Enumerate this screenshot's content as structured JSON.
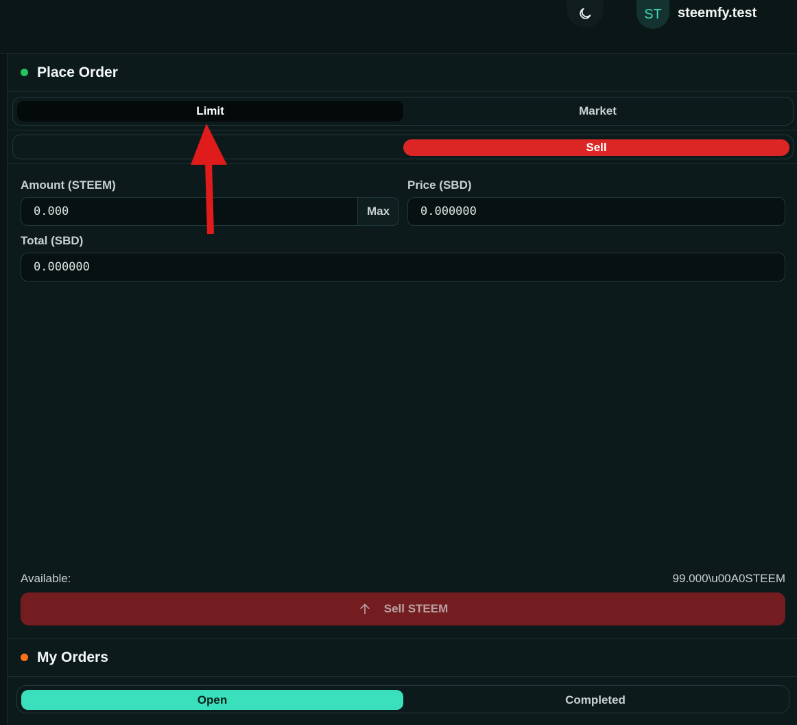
{
  "header": {
    "theme_icon": "moon-icon",
    "avatar_initials": "ST",
    "username": "steemfy.test"
  },
  "place_order": {
    "title": "Place Order",
    "dot_color": "#22c55e",
    "order_types": [
      "Limit",
      "Market"
    ],
    "selected_order_type": "Limit",
    "sides": [
      "Buy",
      "Sell"
    ],
    "selected_side": "Sell",
    "visible_buy_fragment": "y",
    "amount_label": "Amount (STEEM)",
    "amount_value": "0.000",
    "max_label": "Max",
    "price_label": "Price (SBD)",
    "price_value": "0.000000",
    "total_label": "Total (SBD)",
    "total_value": "0.000000",
    "available_label": "Available:",
    "available_value": "99.000\\u00A0STEEM",
    "submit_label": "Sell STEEM",
    "submit_icon": "arrow-up-icon"
  },
  "my_orders": {
    "title": "My Orders",
    "dot_color": "#f97316",
    "tabs": [
      "Open",
      "Completed"
    ],
    "selected_tab": "Open"
  },
  "colors": {
    "accent_teal": "#3ae0bc",
    "sell_red": "#dc2626",
    "sell_button_disabled": "#741d21",
    "annotation_arrow": "#e01b1b"
  }
}
